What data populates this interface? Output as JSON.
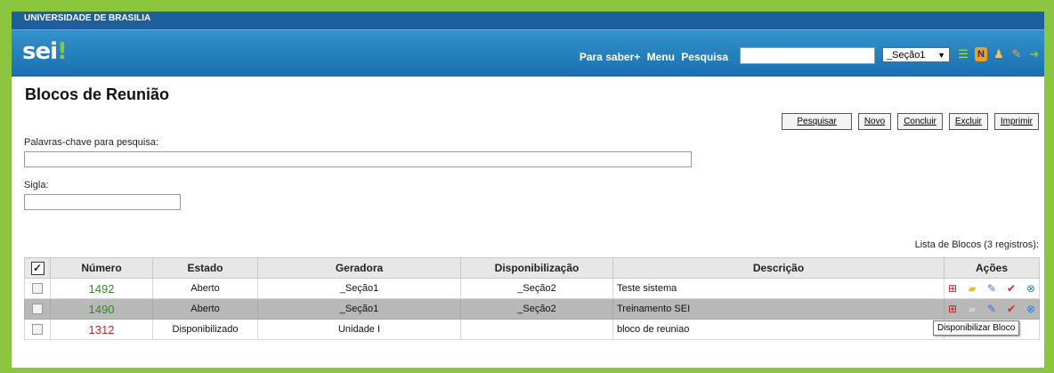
{
  "header": {
    "university": "UNIVERSIDADE DE BRASILIA",
    "logo_main": "sei",
    "logo_suffix": "!",
    "nav": [
      "Para saber+",
      "Menu",
      "Pesquisa"
    ],
    "unit_selected": "_Seção1",
    "icons": [
      "list-icon",
      "n-icon",
      "user-icon",
      "wrench-icon",
      "exit-icon"
    ]
  },
  "page": {
    "title": "Blocos de Reunião",
    "buttons": [
      "Pesquisar",
      "Novo",
      "Concluir",
      "Excluir",
      "Imprimir"
    ],
    "keywords_label": "Palavras-chave para pesquisa:",
    "sigla_label": "Sigla:",
    "list_caption": "Lista de Blocos (3 registros):"
  },
  "table": {
    "headers": [
      "Número",
      "Estado",
      "Geradora",
      "Disponibilização",
      "Descrição",
      "Ações"
    ],
    "rows": [
      {
        "numero": "1492",
        "estado": "Aberto",
        "geradora": "_Seção1",
        "disponibilizacao": "_Seção2",
        "descricao": "Teste sistema",
        "color": "#2e8b1f"
      },
      {
        "numero": "1490",
        "estado": "Aberto",
        "geradora": "_Seção1",
        "disponibilizacao": "_Seção2",
        "descricao": "Treinamento SEI",
        "color": "#2e8b1f"
      },
      {
        "numero": "1312",
        "estado": "Disponibilizado",
        "geradora": "Unidade I",
        "disponibilizacao": "",
        "descricao": "bloco de reuniao",
        "color": "#d62020"
      }
    ]
  },
  "tooltip": "Disponibilizar Bloco",
  "colors": {
    "frame": "#8cc63f",
    "header": "#1a6fb0",
    "selected_row": "#b8b8b8"
  }
}
